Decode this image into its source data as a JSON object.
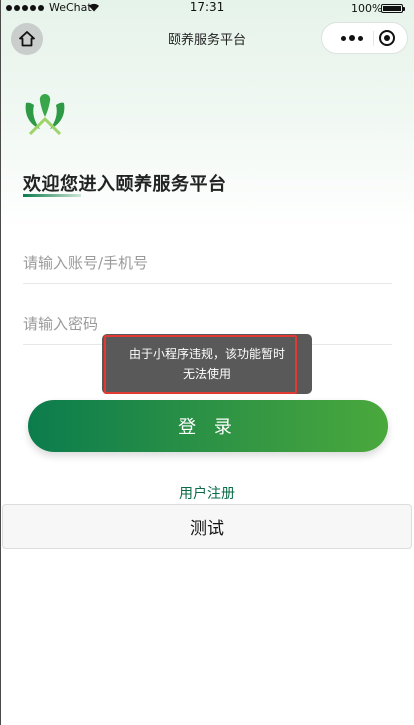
{
  "status_bar": {
    "carrier": "WeChat",
    "time": "17:31",
    "battery": "100%",
    "battery_level": 1.0
  },
  "nav": {
    "title": "颐养服务平台",
    "home_icon": "home-icon",
    "more_icon": "more-dots-icon",
    "close_icon": "target-circle-icon"
  },
  "welcome": {
    "text": "欢迎您进入颐养服务平台"
  },
  "form": {
    "account_placeholder": "请输入账号/手机号",
    "account_value": "",
    "password_placeholder": "请输入密码",
    "password_value": ""
  },
  "buttons": {
    "login": "登 录",
    "register": "用户注册",
    "test": "测试"
  },
  "toast": {
    "message": "由于小程序违规，该功能暂时无法使用"
  },
  "colors": {
    "brand_dark_green": "#0c7c4d",
    "brand_light_green": "#4aa83c",
    "register_link": "#0a6b48",
    "highlight_red": "#e03a33"
  }
}
